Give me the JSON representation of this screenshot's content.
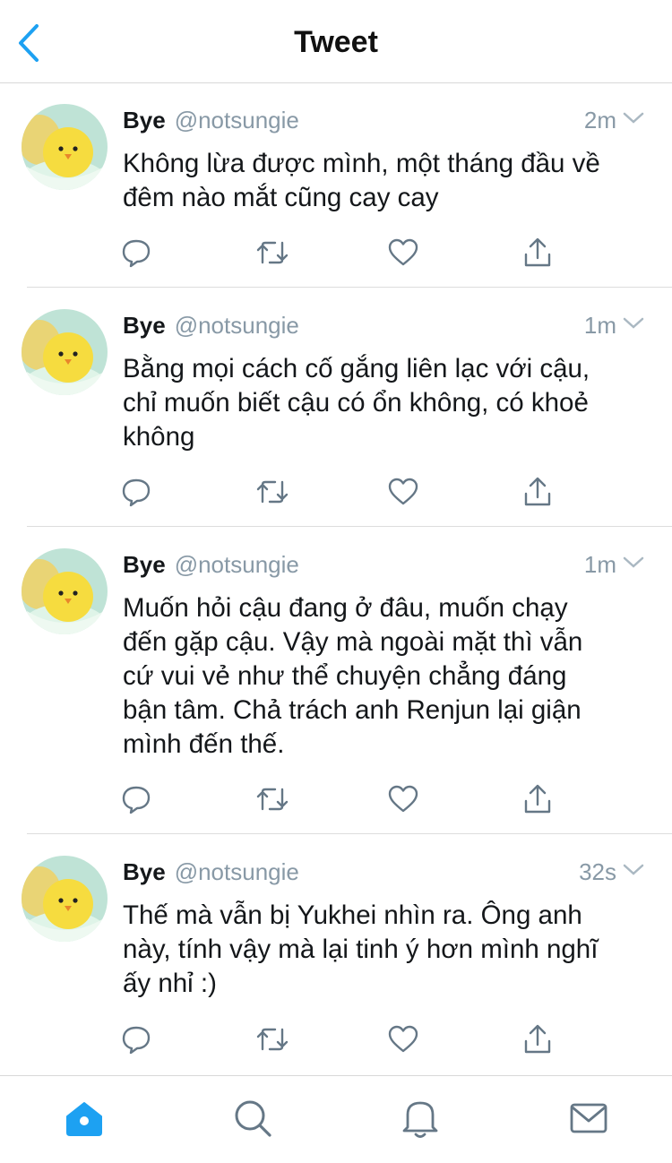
{
  "header": {
    "title": "Tweet"
  },
  "colors": {
    "accent": "#1da1f2",
    "muted": "#8899a6",
    "icon": "#657786"
  },
  "tweets": [
    {
      "name": "Bye",
      "handle": "@notsungie",
      "time": "2m",
      "lines": [
        "Không lừa được mình, một tháng đầu về",
        "đêm nào mắt cũng cay cay"
      ]
    },
    {
      "name": "Bye",
      "handle": "@notsungie",
      "time": "1m",
      "lines": [
        "Bằng mọi cách cố gắng liên lạc với cậu,",
        "chỉ muốn biết cậu có ổn không, có khoẻ",
        "không"
      ]
    },
    {
      "name": "Bye",
      "handle": "@notsungie",
      "time": "1m",
      "lines": [
        "Muốn hỏi cậu đang ở đâu, muốn chạy",
        "đến gặp cậu. Vậy mà ngoài mặt thì vẫn",
        "cứ vui vẻ như thể chuyện chẳng đáng",
        "bận tâm. Chả trách anh Renjun lại giận",
        "mình đến thế."
      ]
    },
    {
      "name": "Bye",
      "handle": "@notsungie",
      "time": "32s",
      "lines": [
        "Thế mà vẫn bị Yukhei nhìn ra. Ông anh",
        "này, tính vậy mà lại tinh ý hơn mình nghĩ",
        "ấy nhỉ :)"
      ]
    }
  ],
  "icons": {
    "back": "chevron-left-icon",
    "reply": "reply-icon",
    "retweet": "retweet-icon",
    "like": "heart-icon",
    "share": "share-icon",
    "more": "chevron-down-icon",
    "home": "home-icon",
    "search": "search-icon",
    "notifications": "bell-icon",
    "messages": "mail-icon"
  }
}
